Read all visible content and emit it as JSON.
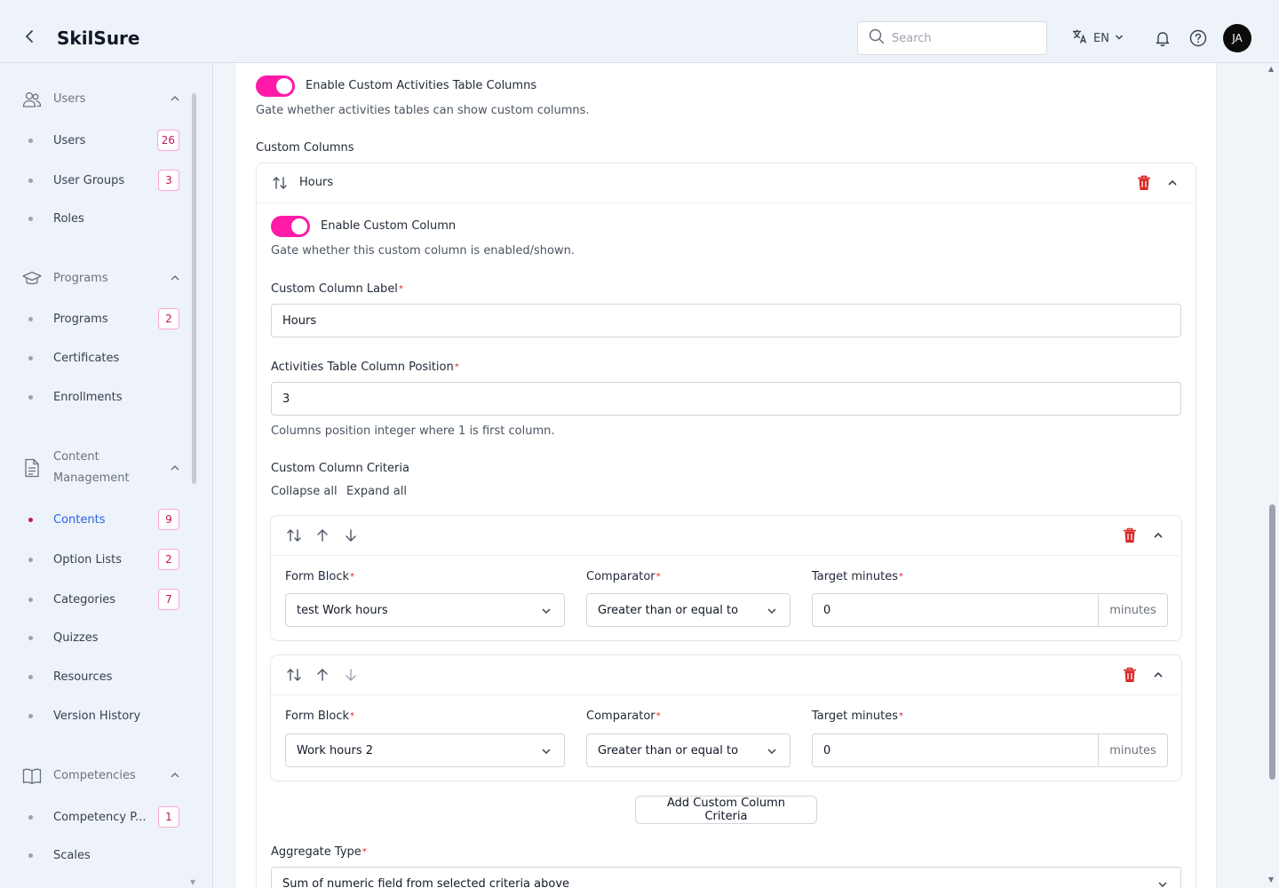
{
  "header": {
    "title": "SkilSure",
    "search_placeholder": "Search",
    "language": "EN",
    "avatar_initials": "JA"
  },
  "sidebar": {
    "groups": [
      {
        "label": "Users",
        "icon": "users-icon",
        "items": [
          {
            "label": "Users",
            "badge": "26"
          },
          {
            "label": "User Groups",
            "badge": "3"
          },
          {
            "label": "Roles",
            "badge": ""
          }
        ]
      },
      {
        "label": "Programs",
        "icon": "graduation-cap-icon",
        "items": [
          {
            "label": "Programs",
            "badge": "2"
          },
          {
            "label": "Certificates",
            "badge": ""
          },
          {
            "label": "Enrollments",
            "badge": ""
          }
        ]
      },
      {
        "label_line1": "Content",
        "label_line2": "Management",
        "icon": "document-icon",
        "items": [
          {
            "label": "Contents",
            "badge": "9",
            "active": true
          },
          {
            "label": "Option Lists",
            "badge": "2"
          },
          {
            "label": "Categories",
            "badge": "7"
          },
          {
            "label": "Quizzes",
            "badge": ""
          },
          {
            "label": "Resources",
            "badge": ""
          },
          {
            "label": "Version History",
            "badge": ""
          }
        ]
      },
      {
        "label": "Competencies",
        "icon": "book-icon",
        "items": [
          {
            "label": "Competency P...",
            "badge": "1"
          },
          {
            "label": "Scales",
            "badge": ""
          }
        ]
      }
    ]
  },
  "main": {
    "enable_custom_columns_label": "Enable Custom Activities Table Columns",
    "enable_custom_columns_help": "Gate whether activities tables can show custom columns.",
    "custom_columns_title": "Custom Columns",
    "column": {
      "name": "Hours",
      "enable_label": "Enable Custom Column",
      "enable_help": "Gate whether this custom column is enabled/shown.",
      "label_field_label": "Custom Column Label",
      "label_value": "Hours",
      "position_field_label": "Activities Table Column Position",
      "position_value": "3",
      "position_help": "Columns position integer where 1 is first column.",
      "criteria_title": "Custom Column Criteria",
      "collapse_all": "Collapse all",
      "expand_all": "Expand all",
      "criteria": [
        {
          "form_block_label": "Form Block",
          "form_block_value": "test Work hours",
          "comparator_label": "Comparator",
          "comparator_value": "Greater than or equal to",
          "target_label": "Target minutes",
          "target_value": "0",
          "target_suffix": "minutes"
        },
        {
          "form_block_label": "Form Block",
          "form_block_value": "Work hours 2",
          "comparator_label": "Comparator",
          "comparator_value": "Greater than or equal to",
          "target_label": "Target minutes",
          "target_value": "0",
          "target_suffix": "minutes"
        }
      ],
      "add_criteria_label": "Add Custom Column Criteria",
      "aggregate_label": "Aggregate Type",
      "aggregate_value": "Sum of numeric field from selected criteria above"
    }
  },
  "colors": {
    "accent_pink": "#ff1aa8",
    "delete_red": "#dc2626",
    "active_blue": "#2563eb"
  }
}
